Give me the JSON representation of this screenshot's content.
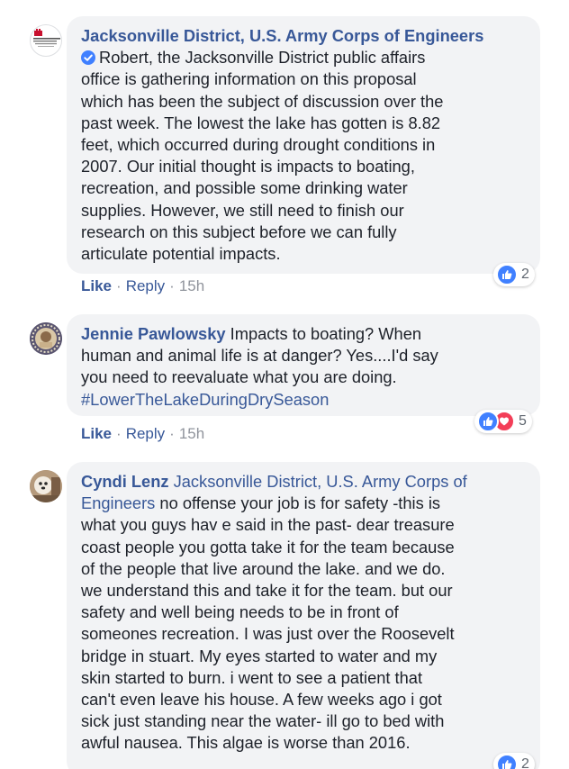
{
  "comments": [
    {
      "author": "Jacksonville District, U.S. Army Corps of Engineers",
      "avatar_icon": "army-corps-logo-icon",
      "verified": true,
      "text_lines": [
        "Robert, the Jacksonville District public affairs",
        "office is gathering information on this proposal",
        "which has been the subject of discussion over the",
        "past week. The lowest the lake has gotten is 8.82",
        "feet, which occurred during drought conditions in",
        "2007. Our initial thought is impacts to boating,",
        "recreation, and possible some drinking water",
        "supplies. However, we still need to finish our",
        "research on this subject before we can fully",
        "articulate potential impacts."
      ],
      "reaction_count": "2",
      "like_label": "Like",
      "reply_label": "Reply",
      "time": "15h"
    },
    {
      "author": "Jennie Pawlowsky",
      "text_lines": [
        "Impacts to boating? When",
        "human and animal life is at danger? Yes....I'd say",
        "you need to reevaluate what you are doing."
      ],
      "hashtag": "#LowerTheLakeDuringDrySeason",
      "reaction_count": "5",
      "like_label": "Like",
      "reply_label": "Reply",
      "time": "15h"
    },
    {
      "author": "Cyndi Lenz",
      "mention_first": "Jacksonville District, U.S. Army Corps of",
      "mention_second": "Engineers",
      "text_first_tail": "no offense your job is for safety -this is",
      "text_lines": [
        "what you guys hav e said in the past- dear treasure",
        "coast people you gotta take it for the team because",
        "of the people that live around the lake. and we do.",
        "we understand this and take it for the team. but our",
        "safety and well being needs to be in front of",
        "someones recreation. I was just over the Roosevelt",
        "bridge in stuart. My eyes started to water and my",
        "skin started to burn. i went to see a patient that",
        "can't even leave his house. A few weeks ago i got",
        "sick just standing near the water- ill go to bed with",
        "awful nausea. This algae is worse than 2016."
      ],
      "reaction_count": "2"
    }
  ],
  "colors": {
    "link": "#385898",
    "bubble": "#f2f3f5",
    "like_blue": "#4080ff",
    "love_red": "#f33e58",
    "meta": "#90949c"
  }
}
